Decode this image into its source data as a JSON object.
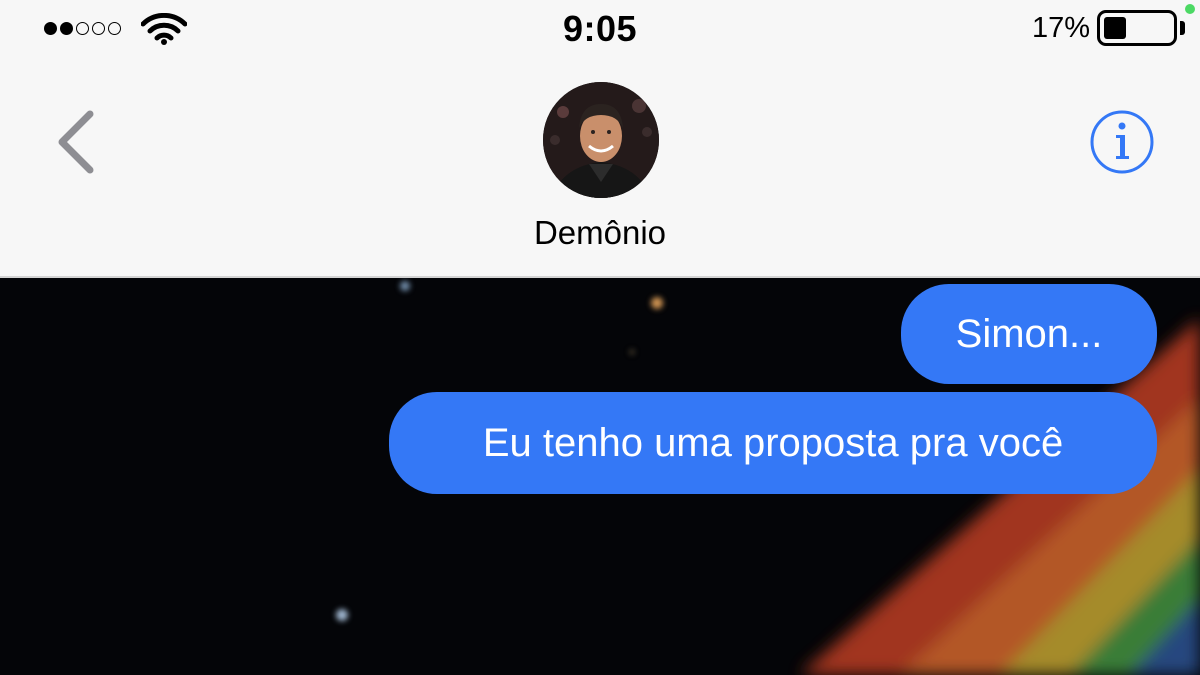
{
  "status_bar": {
    "time": "9:05",
    "battery_percent": "17%",
    "battery_level": 0.17,
    "signal_bars_filled": 2,
    "signal_bars_total": 5
  },
  "nav": {
    "contact_name": "Demônio",
    "back_icon": "chevron-left-icon",
    "info_icon": "info-icon",
    "accent_color": "#3478f6"
  },
  "messages": [
    {
      "direction": "outgoing",
      "text": "Simon..."
    },
    {
      "direction": "outgoing",
      "text": "Eu tenho uma proposta pra você"
    }
  ],
  "colors": {
    "bubble": "#3478f6",
    "header_bg": "#f7f7f7",
    "chat_bg": "#040508"
  }
}
